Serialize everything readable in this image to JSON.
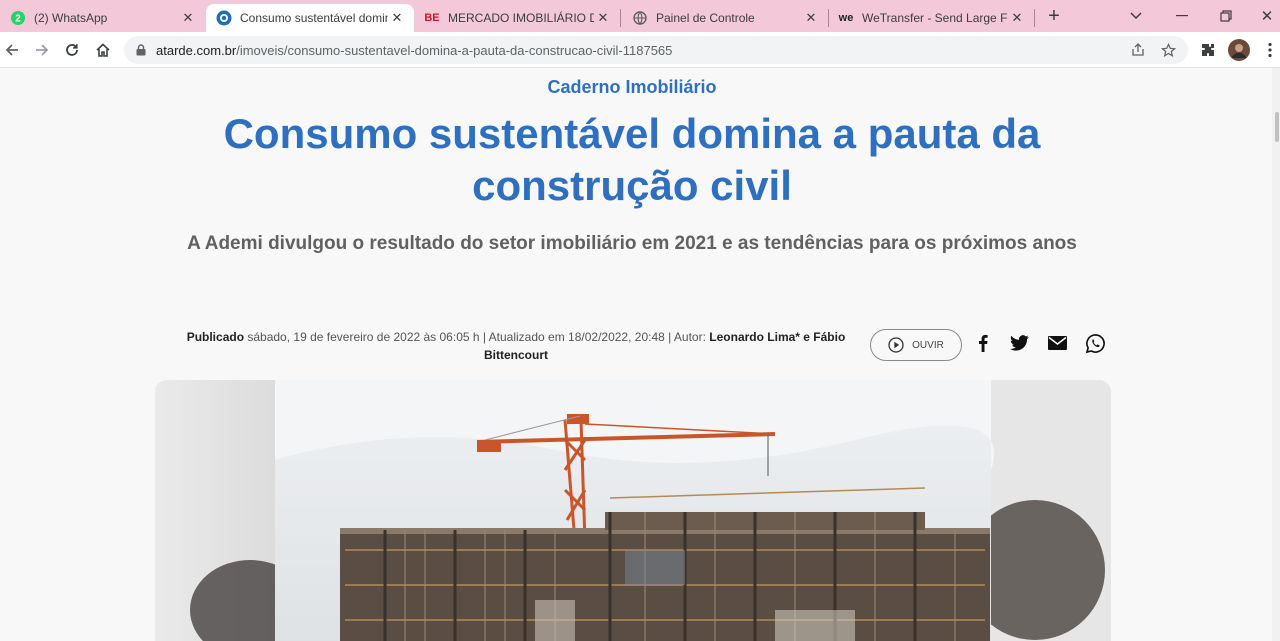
{
  "browser": {
    "tabs": [
      {
        "title": "(2) WhatsApp",
        "badge": "2",
        "active": false
      },
      {
        "title": "Consumo sustentável domin",
        "active": true
      },
      {
        "title": "MERCADO IMOBILIÁRIO DA",
        "favicon_text": "BE",
        "active": false
      },
      {
        "title": "Painel de Controle",
        "active": false
      },
      {
        "title": "WeTransfer - Send Large File",
        "favicon_text": "we",
        "active": false
      }
    ],
    "new_tab": "+",
    "url_host": "atarde.com.br",
    "url_path": "/imoveis/consumo-sustentavel-domina-a-pauta-da-construcao-civil-1187565"
  },
  "article": {
    "section": "Caderno Imobiliário",
    "headline": "Consumo sustentável domina a pauta da construção civil",
    "subtitle": "A Ademi divulgou o resultado do setor imobiliário em 2021 e as tendências para os próximos anos",
    "published_label": "Publicado",
    "published_text": " sábado, 19 de fevereiro de 2022 às 06:05 h | Atualizado em 18/02/2022, 20:48 | Autor: ",
    "authors": "Leonardo Lima* e Fábio Bittencourt",
    "listen_label": "OUVIR"
  },
  "colors": {
    "brand_blue": "#2f6fbf",
    "tab_strip": "#f3c9da",
    "whatsapp_green": "#25d366"
  },
  "icons": [
    "whatsapp-icon",
    "atarde-icon",
    "globe-icon",
    "back-icon",
    "forward-icon",
    "reload-icon",
    "home-icon",
    "lock-icon",
    "share-icon",
    "star-icon",
    "extensions-icon",
    "profile-avatar",
    "menu-icon",
    "play-icon",
    "facebook-icon",
    "twitter-icon",
    "email-icon"
  ]
}
